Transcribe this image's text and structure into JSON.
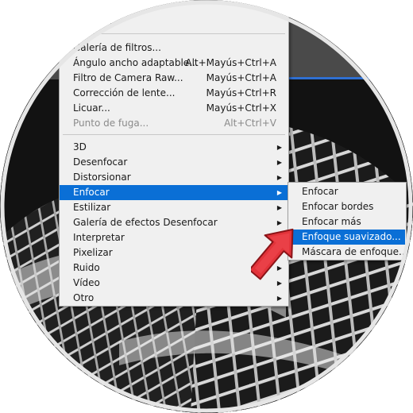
{
  "menu": {
    "top_items": [
      {
        "label": "...ltros...",
        "shortcut": "",
        "disabled": false
      },
      {
        "label": "Galería de filtros...",
        "shortcut": "",
        "disabled": false
      },
      {
        "label": "Ángulo ancho adaptable...",
        "shortcut": "Alt+Mayús+Ctrl+A",
        "disabled": false
      },
      {
        "label": "Filtro de Camera Raw...",
        "shortcut": "Mayús+Ctrl+A",
        "disabled": false
      },
      {
        "label": "Corrección de lente...",
        "shortcut": "Mayús+Ctrl+R",
        "disabled": false
      },
      {
        "label": "Licuar...",
        "shortcut": "Mayús+Ctrl+X",
        "disabled": false
      },
      {
        "label": "Punto de fuga...",
        "shortcut": "Alt+Ctrl+V",
        "disabled": true
      }
    ],
    "submenus": [
      {
        "label": "3D"
      },
      {
        "label": "Desenfocar"
      },
      {
        "label": "Distorsionar"
      },
      {
        "label": "Enfocar",
        "active": true
      },
      {
        "label": "Estilizar"
      },
      {
        "label": "Galería de efectos Desenfocar"
      },
      {
        "label": "Interpretar"
      },
      {
        "label": "Pixelizar"
      },
      {
        "label": "Ruido"
      },
      {
        "label": "Vídeo"
      },
      {
        "label": "Otro"
      }
    ]
  },
  "submenu_enfocar": {
    "items": [
      {
        "label": "Enfocar"
      },
      {
        "label": "Enfocar bordes"
      },
      {
        "label": "Enfocar más"
      },
      {
        "label": "Enfoque suavizado...",
        "highlighted": true
      },
      {
        "label": "Máscara de enfoque..."
      }
    ]
  },
  "icons": {
    "submenu_arrow": "chevron-right-icon",
    "pointer": "red-arrow-pointer-icon"
  },
  "colors": {
    "highlight": "#0a6fd6",
    "menu_bg": "#f0f0f0",
    "pointer": "#e2333a"
  }
}
